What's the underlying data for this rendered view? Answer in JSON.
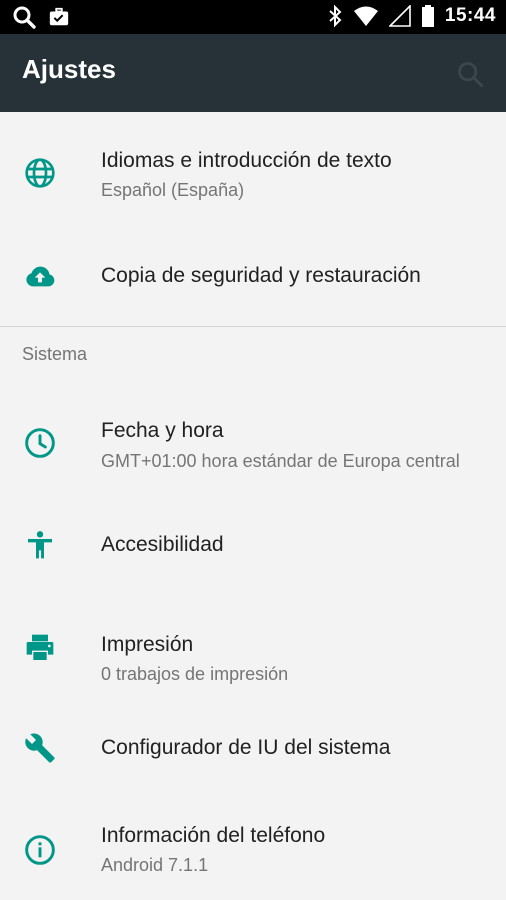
{
  "status_bar": {
    "time": "15:44",
    "icons": [
      "search-icon",
      "briefcase-icon",
      "bluetooth-icon",
      "wifi-icon",
      "signal-icon",
      "battery-icon"
    ]
  },
  "app_bar": {
    "title": "Ajustes",
    "search_icon": "search-icon"
  },
  "colors": {
    "accent": "#009688",
    "app_bar_bg": "#263238",
    "background": "#f3f3f3",
    "primary_text": "#212121",
    "secondary_text": "#757575"
  },
  "settings": {
    "items_top": [
      {
        "title": "Idiomas e introducción de texto",
        "subtitle": "Español (España)",
        "icon": "globe-icon"
      },
      {
        "title": "Copia de seguridad y restauración",
        "subtitle": "",
        "icon": "cloud-upload-icon"
      }
    ],
    "section_title": "Sistema",
    "items_system": [
      {
        "title": "Fecha y hora",
        "subtitle": "GMT+01:00 hora estándar de Europa central",
        "icon": "clock-icon"
      },
      {
        "title": "Accesibilidad",
        "subtitle": "",
        "icon": "accessibility-icon"
      },
      {
        "title": "Impresión",
        "subtitle": "0 trabajos de impresión",
        "icon": "printer-icon"
      },
      {
        "title": "Configurador de IU del sistema",
        "subtitle": "",
        "icon": "wrench-icon"
      },
      {
        "title": "Información del teléfono",
        "subtitle": "Android 7.1.1",
        "icon": "info-icon"
      }
    ]
  }
}
